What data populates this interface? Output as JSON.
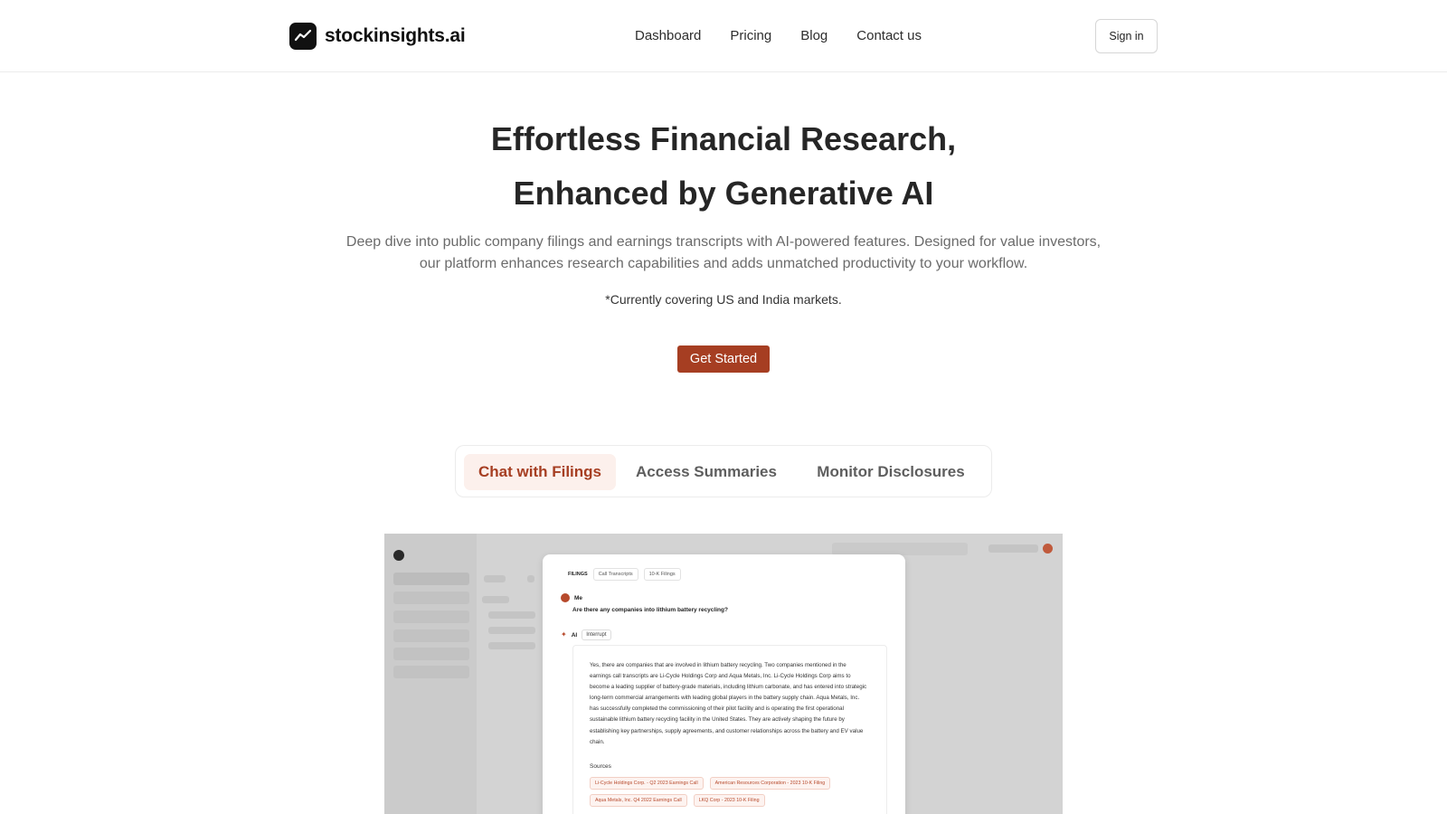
{
  "header": {
    "brand": "stockinsights.ai",
    "nav": [
      {
        "label": "Dashboard"
      },
      {
        "label": "Pricing"
      },
      {
        "label": "Blog"
      },
      {
        "label": "Contact us"
      }
    ],
    "signin_label": "Sign in"
  },
  "hero": {
    "title_line1": "Effortless Financial Research,",
    "title_line2": "Enhanced by Generative AI",
    "subtitle": "Deep dive into public company filings and earnings transcripts with AI-powered features. Designed for value investors, our platform enhances research capabilities and adds unmatched productivity to your workflow.",
    "note": "*Currently covering US and India markets.",
    "cta_label": "Get Started"
  },
  "feature_tabs": [
    {
      "label": "Chat with Filings",
      "active": true
    },
    {
      "label": "Access Summaries",
      "active": false
    },
    {
      "label": "Monitor Disclosures",
      "active": false
    }
  ],
  "preview": {
    "filter_label": "FILINGS",
    "filter_tabs": [
      "Call Transcripts",
      "10-K Filings"
    ],
    "user_label": "Me",
    "question": "Are there any companies into lithium battery recycling?",
    "ai_label": "AI",
    "interrupt_label": "Interrupt",
    "answer": "Yes, there are companies that are involved in lithium battery recycling. Two companies mentioned in the earnings call transcripts are Li-Cycle Holdings Corp and Aqua Metals, Inc. Li-Cycle Holdings Corp aims to become a leading supplier of battery-grade materials, including lithium carbonate, and has entered into strategic long-term commercial arrangements with leading global players in the battery supply chain. Aqua Metals, Inc. has successfully completed the commissioning of their pilot facility and is operating the first operational sustainable lithium battery recycling facility in the United States. They are actively shaping the future by establishing key partnerships, supply agreements, and customer relationships across the battery and EV value chain.",
    "sources_label": "Sources",
    "sources": [
      "Li-Cycle Holdings Corp. - Q2 2023 Earnings Call",
      "American Resources Corporation - 2023 10-K Filing",
      "Aqua Metals, Inc. Q4 2022 Earnings Call",
      "LKQ Corp - 2023 10-K Filing"
    ]
  },
  "colors": {
    "accent": "#a63e22",
    "accent_tint": "#fcf0ec",
    "text": "#262626",
    "muted": "#6b6b6b"
  },
  "icons": {
    "logo": "trend-line-icon",
    "ai": "sparkle-icon"
  }
}
